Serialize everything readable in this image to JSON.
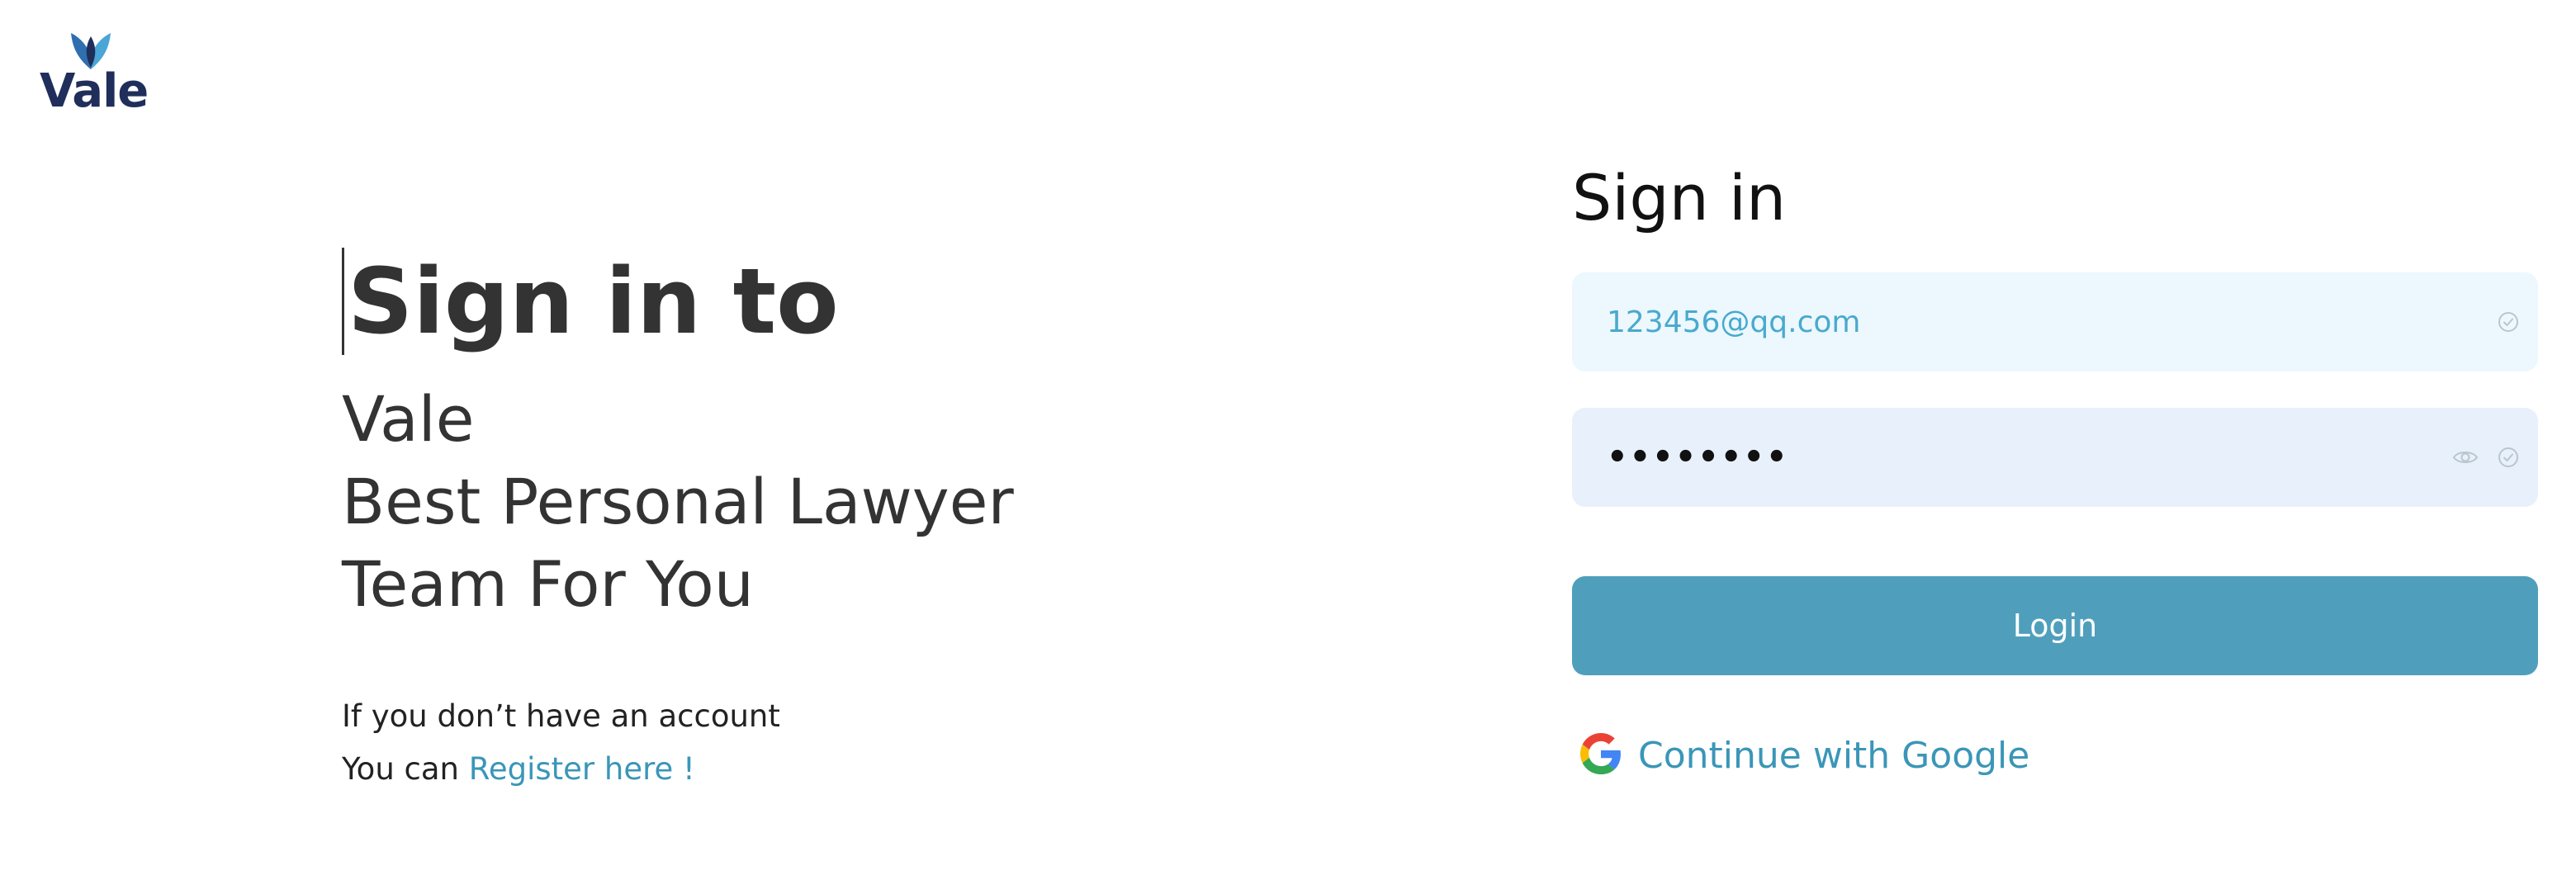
{
  "logo": {
    "text": "Vale",
    "icon": "vale-leaf-logo",
    "colors": {
      "dark": "#1f2e5a",
      "light": "#4aa6d6"
    }
  },
  "hero": {
    "title": "Sign in to",
    "lines": [
      "Vale",
      "Best Personal Lawyer",
      "Team For You"
    ],
    "note_line1": "If you don’t have an account",
    "note_prefix": "You can",
    "register_link": "Register here !"
  },
  "form": {
    "title": "Sign in",
    "email_value": "123456@qq.com",
    "password_value": "••••••••",
    "login_label": "Login",
    "google_label": "Continue with Google"
  },
  "colors": {
    "accent": "#4f9fbc",
    "link": "#3a96b8",
    "email_bg": "#ecf8fd",
    "password_bg": "#e8f0fb"
  },
  "icons": {
    "email_status": "check-circle-icon",
    "password_toggle": "eye-icon",
    "password_status": "check-circle-icon",
    "google": "google-icon"
  }
}
